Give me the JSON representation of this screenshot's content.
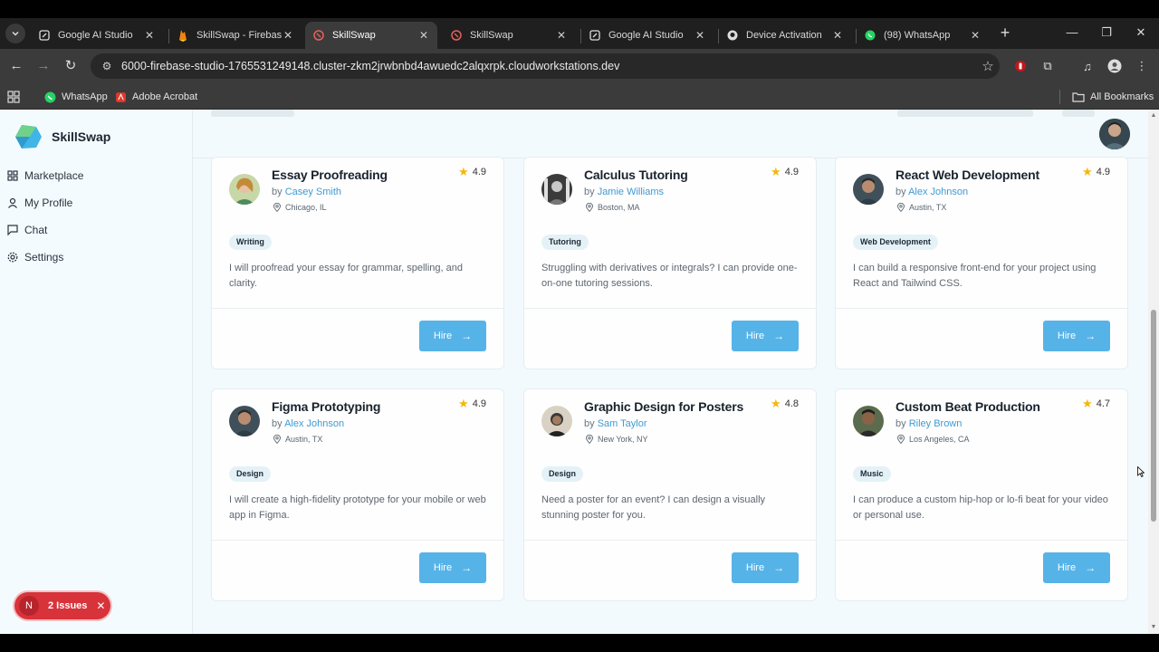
{
  "browser": {
    "tabs": [
      {
        "title": "Google AI Studio",
        "icon": "ai-studio-icon",
        "active": false
      },
      {
        "title": "SkillSwap - Firebase S",
        "icon": "firebase-icon",
        "active": false
      },
      {
        "title": "SkillSwap",
        "icon": "skillswap-icon",
        "active": true
      },
      {
        "title": "SkillSwap",
        "icon": "skillswap-icon",
        "active": false
      },
      {
        "title": "Google AI Studio",
        "icon": "ai-studio-icon",
        "active": false
      },
      {
        "title": "Device Activation",
        "icon": "github-icon",
        "active": false
      },
      {
        "title": "(98) WhatsApp",
        "icon": "whatsapp-icon",
        "active": false
      }
    ],
    "url": "6000-firebase-studio-1765531249148.cluster-zkm2jrwbnbd4awuedc2alqxrpk.cloudworkstations.dev",
    "bookmarks": [
      {
        "label": "WhatsApp",
        "icon": "whatsapp-icon"
      },
      {
        "label": "Adobe Acrobat",
        "icon": "acrobat-icon"
      }
    ],
    "all_bookmarks": "All Bookmarks"
  },
  "app": {
    "brand": "SkillSwap",
    "nav": [
      {
        "label": "Marketplace",
        "icon": "marketplace-icon"
      },
      {
        "label": "My Profile",
        "icon": "profile-icon"
      },
      {
        "label": "Chat",
        "icon": "chat-icon"
      },
      {
        "label": "Settings",
        "icon": "settings-icon"
      }
    ],
    "cards": [
      {
        "title": "Essay Proofreading",
        "by": "by",
        "provider": "Casey Smith",
        "location": "Chicago, IL",
        "rating": "4.9",
        "tag": "Writing",
        "description": "I will proofread your essay for grammar, spelling, and clarity.",
        "button": "Hire"
      },
      {
        "title": "Calculus Tutoring",
        "by": "by",
        "provider": "Jamie Williams",
        "location": "Boston, MA",
        "rating": "4.9",
        "tag": "Tutoring",
        "description": "Struggling with derivatives or integrals? I can provide one-on-one tutoring sessions.",
        "button": "Hire"
      },
      {
        "title": "React Web Development",
        "by": "by",
        "provider": "Alex Johnson",
        "location": "Austin, TX",
        "rating": "4.9",
        "tag": "Web Development",
        "description": "I can build a responsive front-end for your project using React and Tailwind CSS.",
        "button": "Hire"
      },
      {
        "title": "Figma Prototyping",
        "by": "by",
        "provider": "Alex Johnson",
        "location": "Austin, TX",
        "rating": "4.9",
        "tag": "Design",
        "description": "I will create a high-fidelity prototype for your mobile or web app in Figma.",
        "button": "Hire"
      },
      {
        "title": "Graphic Design for Posters",
        "by": "by",
        "provider": "Sam Taylor",
        "location": "New York, NY",
        "rating": "4.8",
        "tag": "Design",
        "description": "Need a poster for an event? I can design a visually stunning poster for you.",
        "button": "Hire"
      },
      {
        "title": "Custom Beat Production",
        "by": "by",
        "provider": "Riley Brown",
        "location": "Los Angeles, CA",
        "rating": "4.7",
        "tag": "Music",
        "description": "I can produce a custom hip-hop or lo-fi beat for your video or personal use.",
        "button": "Hire"
      }
    ],
    "issues": {
      "badge": "N",
      "label": "2 Issues"
    }
  },
  "colors": {
    "accent": "#56b3e7",
    "provider_link": "#3e9bd4",
    "star": "#f5b70a",
    "issues": "#d8333a",
    "background": "#f2fafd"
  }
}
